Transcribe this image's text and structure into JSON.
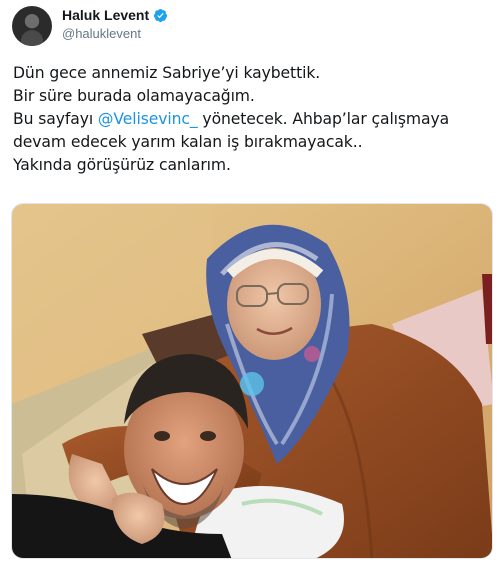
{
  "tweet": {
    "author": {
      "display_name": "Haluk Levent",
      "handle": "@haluklevent",
      "verified": true,
      "avatar_icon": "avatar-photo"
    },
    "text": {
      "line1": "Dün gece annemiz Sabriye’yi kaybettik.",
      "line2": "Bir süre burada olamayacağım.",
      "line3_before": "Bu sayfayı ",
      "line3_mention": "@Velisevinc_",
      "line3_after": " yönetecek. Ahbap’lar çalışmaya",
      "line4": "devam edecek yarım kalan iş bırakmayacak..",
      "line5": "Yakında görüşürüz canlarım."
    },
    "media": {
      "type": "photo",
      "icon": "photo-image"
    }
  },
  "colors": {
    "link": "#1b95e0",
    "verified": "#1da1f2",
    "secondary_text": "#657786"
  }
}
